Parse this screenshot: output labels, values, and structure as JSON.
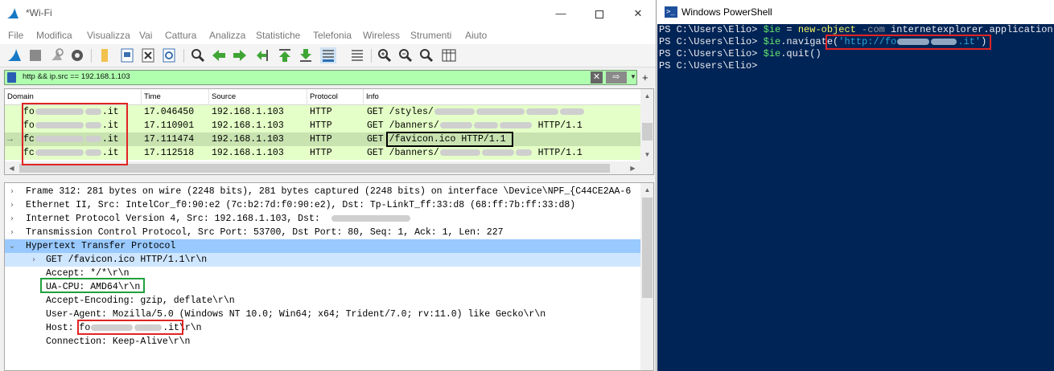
{
  "wireshark": {
    "title": "*Wi-Fi",
    "window_buttons": {
      "minimize": "—",
      "close": "✕"
    },
    "menu": [
      "File",
      "Modifica",
      "Visualizza",
      "Vai",
      "Cattura",
      "Analizza",
      "Statistiche",
      "Telefonia",
      "Wireless",
      "Strumenti",
      "Aiuto"
    ],
    "filter": {
      "value": "http && ip.src == 192.168.1.103",
      "add_label": "+"
    },
    "packet_list": {
      "headers": [
        "Domain",
        "Time",
        "Source",
        "Protocol",
        "Info"
      ],
      "rows": [
        {
          "domain_start": "fo",
          "domain_end": ".it",
          "time": "17.046450",
          "source": "192.168.1.103",
          "protocol": "HTTP",
          "info_start": "GET /styles/",
          "info_end": "",
          "selected": false
        },
        {
          "domain_start": "fo",
          "domain_end": ".it",
          "time": "17.110901",
          "source": "192.168.1.103",
          "protocol": "HTTP",
          "info_start": "GET /banners/",
          "info_end": "HTTP/1.1",
          "selected": false
        },
        {
          "domain_start": "fc",
          "domain_end": ".it",
          "time": "17.111474",
          "source": "192.168.1.103",
          "protocol": "HTTP",
          "info_start": "GET /favicon.ico HTTP/1.1",
          "info_end": "",
          "selected": true
        },
        {
          "domain_start": "fc",
          "domain_end": ".it",
          "time": "17.112518",
          "source": "192.168.1.103",
          "protocol": "HTTP",
          "info_start": "GET /banners/",
          "info_end": "HTTP/1.1",
          "selected": false
        }
      ]
    },
    "details": [
      {
        "indent": 0,
        "expander": "›",
        "text": "Frame 312: 281 bytes on wire (2248 bits), 281 bytes captured (2248 bits) on interface \\Device\\NPF_{C44CE2AA-6",
        "style": ""
      },
      {
        "indent": 0,
        "expander": "›",
        "text": "Ethernet II, Src: IntelCor_f0:90:e2 (7c:b2:7d:f0:90:e2), Dst: Tp-LinkT_ff:33:d8 (68:ff:7b:ff:33:d8)",
        "style": ""
      },
      {
        "indent": 0,
        "expander": "›",
        "text": "Internet Protocol Version 4, Src: 192.168.1.103, Dst:",
        "style": ""
      },
      {
        "indent": 0,
        "expander": "›",
        "text": "Transmission Control Protocol, Src Port: 53700, Dst Port: 80, Seq: 1, Ack: 1, Len: 227",
        "style": ""
      },
      {
        "indent": 0,
        "expander": "⌄",
        "text": "Hypertext Transfer Protocol",
        "style": "sel"
      },
      {
        "indent": 1,
        "expander": "›",
        "text": "GET /favicon.ico HTTP/1.1\\r\\n",
        "style": "sub"
      },
      {
        "indent": 1,
        "expander": "",
        "text": "Accept: */*\\r\\n",
        "style": ""
      },
      {
        "indent": 1,
        "expander": "",
        "text": "UA-CPU: AMD64\\r\\n",
        "style": ""
      },
      {
        "indent": 1,
        "expander": "",
        "text": "Accept-Encoding: gzip, deflate\\r\\n",
        "style": ""
      },
      {
        "indent": 1,
        "expander": "",
        "text": "User-Agent: Mozilla/5.0 (Windows NT 10.0; Win64; x64; Trident/7.0; rv:11.0) like Gecko\\r\\n",
        "style": ""
      },
      {
        "indent": 1,
        "expander": "",
        "text": "Host: ",
        "style": ""
      },
      {
        "indent": 1,
        "expander": "",
        "text": "Connection: Keep-Alive\\r\\n",
        "style": ""
      }
    ],
    "host_parts": {
      "start": "fo",
      "end": ".it",
      "tail": "\\r\\n"
    }
  },
  "powershell": {
    "title": "Windows PowerShell",
    "prompt": "PS C:\\Users\\Elio>",
    "line1": {
      "var": "$ie",
      "eq": " = ",
      "cmd": "new-object",
      "param": " -com ",
      "arg": "internetexplorer.application"
    },
    "line2": {
      "var": "$ie",
      "method": ".navigate(",
      "str_start": "'http://fo",
      "str_end": ".it'",
      "close": ")"
    },
    "line3": {
      "var": "$ie",
      "method": ".quit()"
    }
  },
  "colors": {
    "annotation_red": "#e02424",
    "annotation_black": "#000000",
    "annotation_green": "#1fa03c",
    "filter_bg": "#afffaf",
    "row_bg": "#e4ffc7",
    "row_selected": "#c8e2b0",
    "detail_selected": "#99c9ff",
    "powershell_bg": "#012456"
  }
}
